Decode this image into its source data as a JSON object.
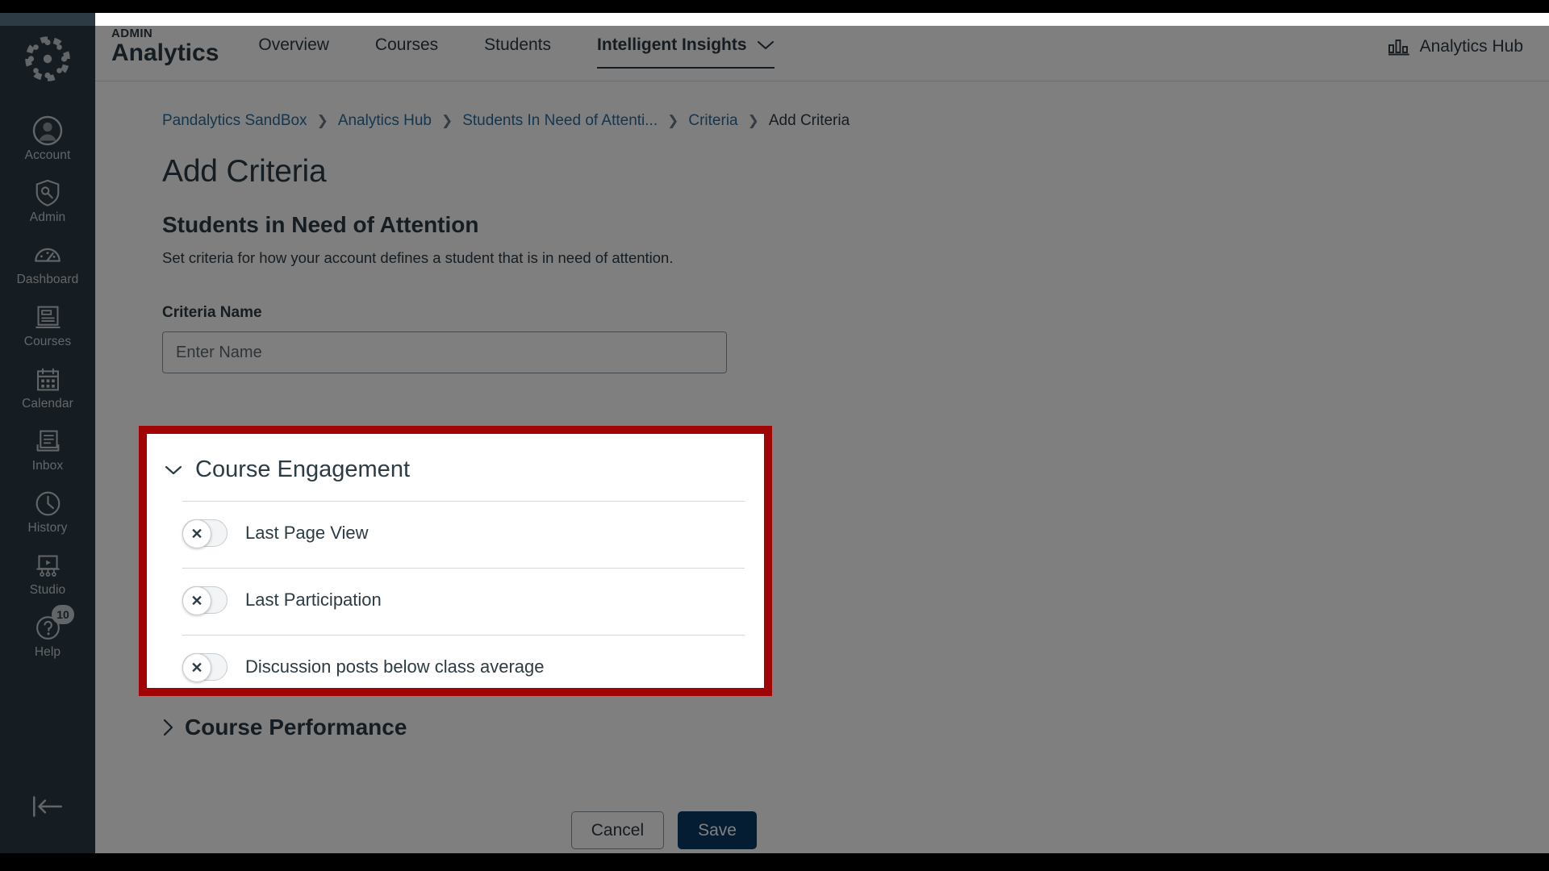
{
  "app": {
    "brand_eyebrow": "ADMIN",
    "brand_title": "Analytics",
    "hub_link_label": "Analytics Hub"
  },
  "global_nav": {
    "logo_icon": "canvas-logo-icon",
    "items": [
      {
        "label": "Account",
        "icon": "user-circle-icon"
      },
      {
        "label": "Admin",
        "icon": "shield-wrench-icon"
      },
      {
        "label": "Dashboard",
        "icon": "gauge-icon"
      },
      {
        "label": "Courses",
        "icon": "book-icon"
      },
      {
        "label": "Calendar",
        "icon": "calendar-icon"
      },
      {
        "label": "Inbox",
        "icon": "inbox-tray-icon"
      },
      {
        "label": "History",
        "icon": "clock-icon"
      },
      {
        "label": "Studio",
        "icon": "studio-screen-icon"
      },
      {
        "label": "Help",
        "icon": "question-circle-icon",
        "badge": "10"
      }
    ],
    "collapse_icon": "collapse-left-arrow-icon"
  },
  "top_tabs": [
    {
      "label": "Overview",
      "active": false
    },
    {
      "label": "Courses",
      "active": false
    },
    {
      "label": "Students",
      "active": false
    },
    {
      "label": "Intelligent Insights",
      "active": true,
      "chevron": "chevron-down-icon"
    }
  ],
  "breadcrumb": [
    {
      "label": "Pandalytics SandBox",
      "current": false
    },
    {
      "label": "Analytics Hub",
      "current": false
    },
    {
      "label": "Students In Need of Attenti...",
      "current": false
    },
    {
      "label": "Criteria",
      "current": false
    },
    {
      "label": "Add Criteria",
      "current": true
    }
  ],
  "page": {
    "title": "Add Criteria",
    "section_title": "Students in Need of Attention",
    "section_description": "Set criteria for how your account defines a student that is in need of attention."
  },
  "form": {
    "criteria_name_label": "Criteria Name",
    "criteria_name_value": "",
    "criteria_name_placeholder": "Enter Name"
  },
  "accordions": {
    "course_engagement": {
      "title": "Course Engagement",
      "expanded": true,
      "chevron_icon": "chevron-down-icon",
      "rows": [
        {
          "label": "Last Page View",
          "enabled": false,
          "toggle_glyph": "✕"
        },
        {
          "label": "Last Participation",
          "enabled": false,
          "toggle_glyph": "✕"
        },
        {
          "label": "Discussion posts below class average",
          "enabled": false,
          "toggle_glyph": "✕"
        }
      ]
    },
    "course_performance": {
      "title": "Course Performance",
      "expanded": false,
      "chevron_icon": "chevron-right-icon"
    }
  },
  "actions": {
    "cancel_label": "Cancel",
    "save_label": "Save"
  },
  "colors": {
    "nav_background": "#2d3b45",
    "link_blue": "#2b6c9b",
    "save_button": "#0b3b66",
    "highlight_border": "#a00404",
    "text_primary": "#2d3b45"
  }
}
